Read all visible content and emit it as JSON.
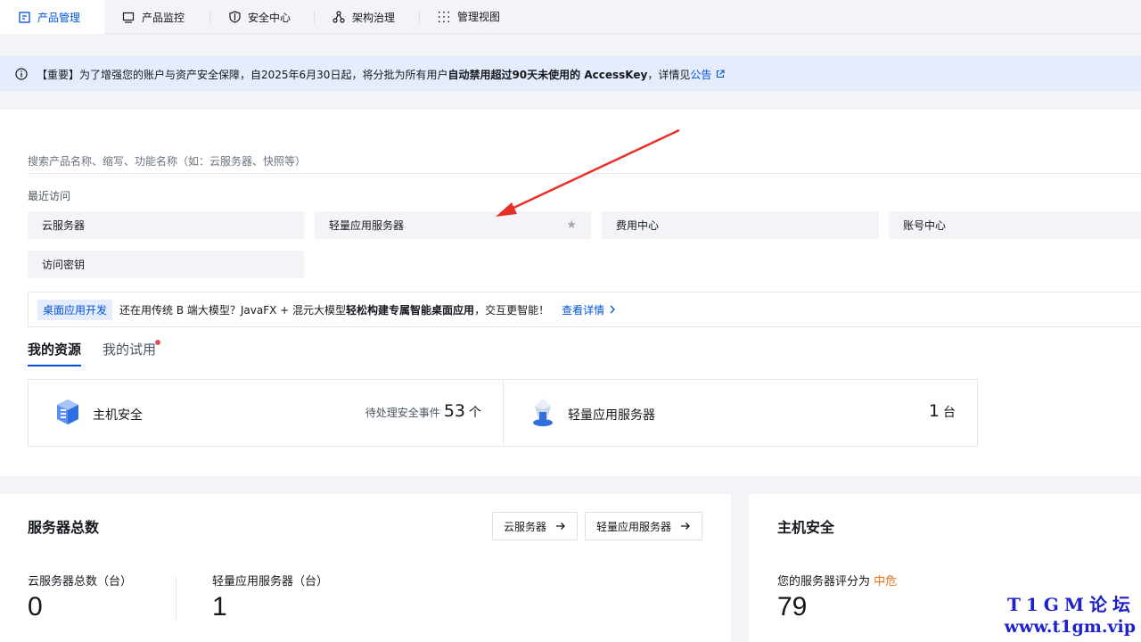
{
  "tabs": [
    {
      "label": "产品管理",
      "icon": "document-icon",
      "active": true
    },
    {
      "label": "产品监控",
      "icon": "monitor-icon",
      "active": false
    },
    {
      "label": "安全中心",
      "icon": "shield-icon",
      "active": false
    },
    {
      "label": "架构治理",
      "icon": "architecture-icon",
      "active": false
    },
    {
      "label": "管理视图",
      "icon": "grid-dots-icon",
      "active": false
    }
  ],
  "notice": {
    "prefix": "【重要】为了增强您的账户与资产安全保障，自2025年6月30日起，将分批为所有用户",
    "bold": "自动禁用超过90天未使用的 AccessKey",
    "suffix": "，详情见",
    "link": "公告"
  },
  "search": {
    "placeholder": "搜索产品名称、缩写、功能名称（如：云服务器、快照等）"
  },
  "recent": {
    "title": "最近访问",
    "items": [
      "云服务器",
      "轻量应用服务器",
      "费用中心",
      "账号中心",
      "访问密钥"
    ]
  },
  "promo": {
    "tag": "桌面应用开发",
    "prefix": "还在用传统 B 端大模型？JavaFX + 混元大模型",
    "bold": "轻松构建专属智能桌面应用",
    "suffix": "，交互更智能！",
    "link": "查看详情"
  },
  "resources": {
    "tabs": [
      "我的资源",
      "我的试用"
    ],
    "cards": [
      {
        "name": "主机安全",
        "label": "待处理安全事件",
        "value": "53",
        "unit": "个",
        "icon": "host-security-icon"
      },
      {
        "name": "轻量应用服务器",
        "label": "",
        "value": "1",
        "unit": "台",
        "icon": "lighthouse-server-icon"
      }
    ]
  },
  "servers": {
    "title": "服务器总数",
    "links": [
      "云服务器",
      "轻量应用服务器"
    ],
    "stats": [
      {
        "label": "云服务器总数（台）",
        "value": "0"
      },
      {
        "label": "轻量应用服务器（台）",
        "value": "1"
      }
    ]
  },
  "host_security": {
    "title": "主机安全",
    "score_label": "您的服务器评分为",
    "risk": "中危",
    "score": "79"
  },
  "watermark": {
    "line1": "T1GM论坛",
    "line2": "www.t1gm.vip"
  },
  "colors": {
    "brand": "#0052d9",
    "notice_bg": "#e5edfd",
    "warning": "#e37318",
    "annotation_arrow": "#e8302a"
  }
}
